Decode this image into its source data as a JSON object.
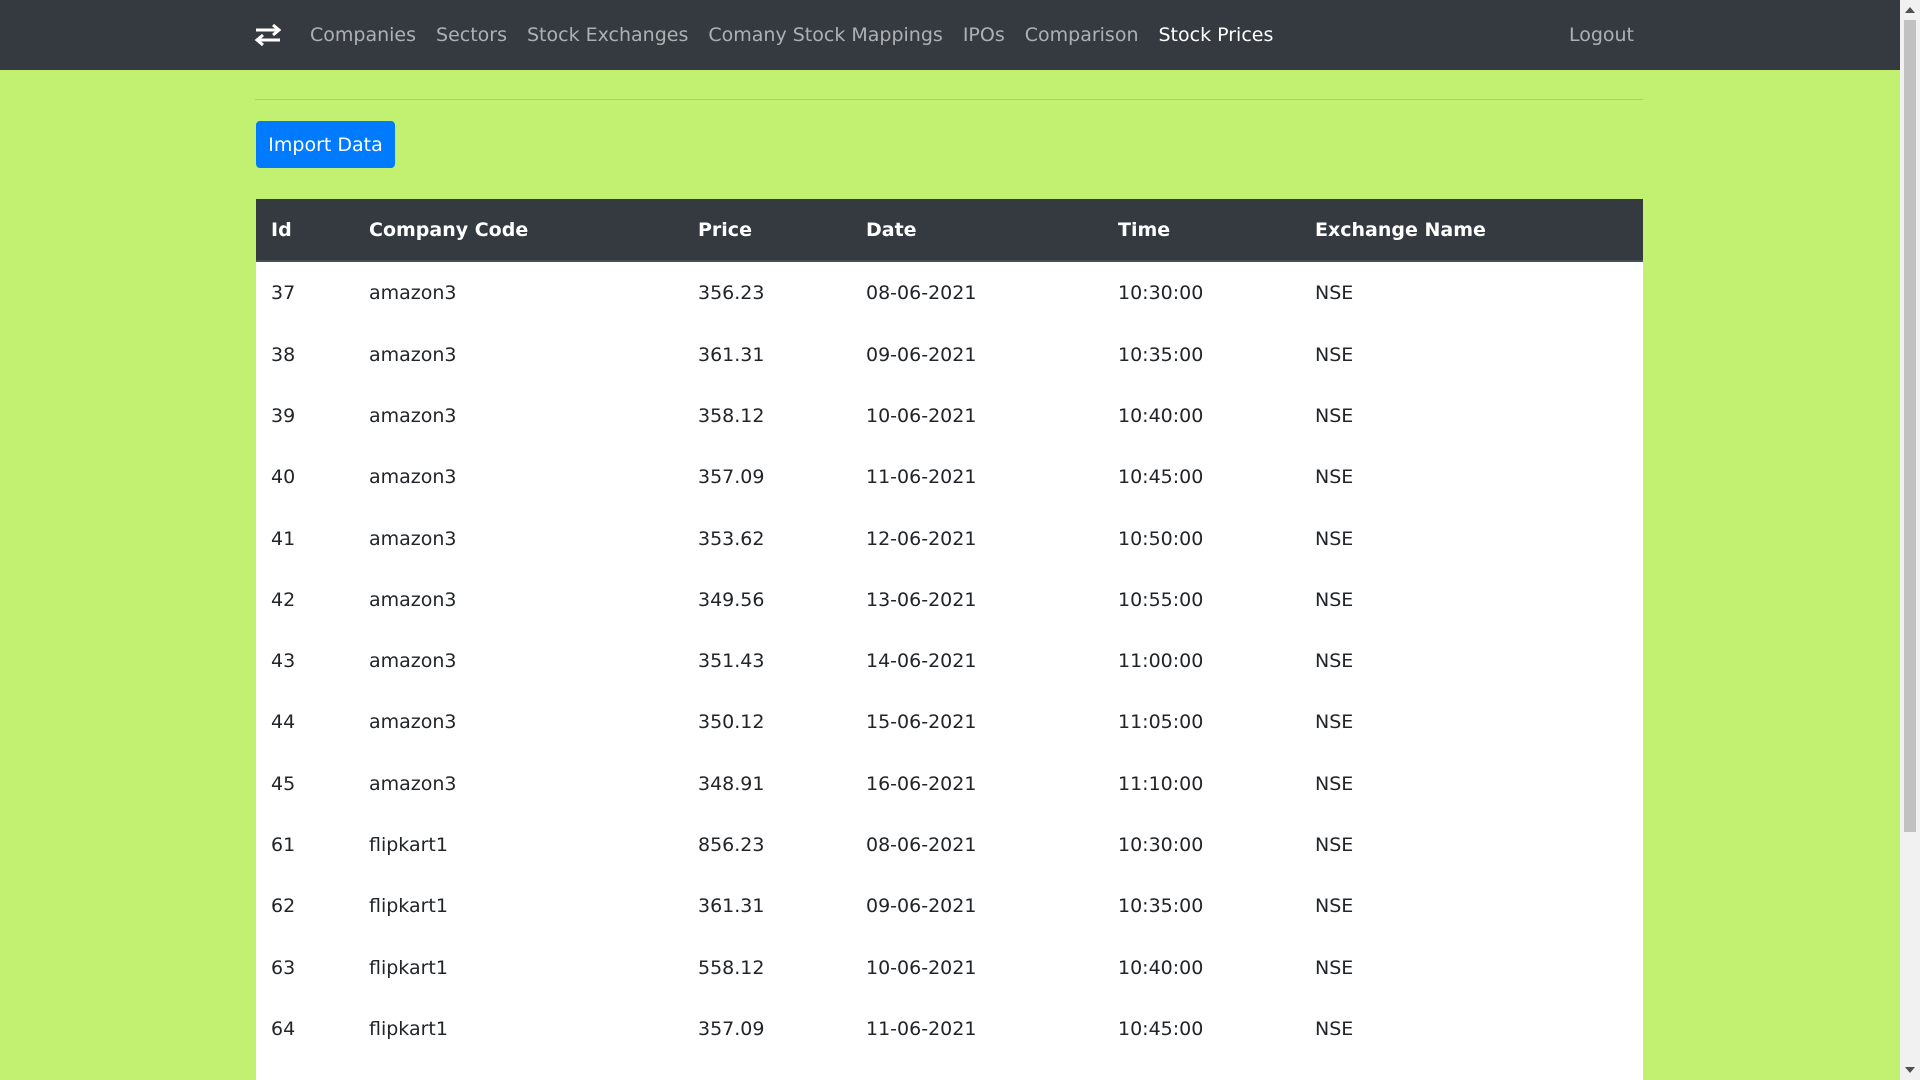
{
  "navbar": {
    "brand_icon": "arrows-exchange-icon",
    "links": [
      {
        "label": "Companies",
        "active": false
      },
      {
        "label": "Sectors",
        "active": false
      },
      {
        "label": "Stock Exchanges",
        "active": false
      },
      {
        "label": "Comany Stock Mappings",
        "active": false
      },
      {
        "label": "IPOs",
        "active": false
      },
      {
        "label": "Comparison",
        "active": false
      },
      {
        "label": "Stock Prices",
        "active": true
      }
    ],
    "logout_label": "Logout"
  },
  "import_button_label": "Import Data",
  "table": {
    "headers": [
      "Id",
      "Company Code",
      "Price",
      "Date",
      "Time",
      "Exchange Name"
    ],
    "rows": [
      [
        "37",
        "amazon3",
        "356.23",
        "08-06-2021",
        "10:30:00",
        "NSE"
      ],
      [
        "38",
        "amazon3",
        "361.31",
        "09-06-2021",
        "10:35:00",
        "NSE"
      ],
      [
        "39",
        "amazon3",
        "358.12",
        "10-06-2021",
        "10:40:00",
        "NSE"
      ],
      [
        "40",
        "amazon3",
        "357.09",
        "11-06-2021",
        "10:45:00",
        "NSE"
      ],
      [
        "41",
        "amazon3",
        "353.62",
        "12-06-2021",
        "10:50:00",
        "NSE"
      ],
      [
        "42",
        "amazon3",
        "349.56",
        "13-06-2021",
        "10:55:00",
        "NSE"
      ],
      [
        "43",
        "amazon3",
        "351.43",
        "14-06-2021",
        "11:00:00",
        "NSE"
      ],
      [
        "44",
        "amazon3",
        "350.12",
        "15-06-2021",
        "11:05:00",
        "NSE"
      ],
      [
        "45",
        "amazon3",
        "348.91",
        "16-06-2021",
        "11:10:00",
        "NSE"
      ],
      [
        "61",
        "flipkart1",
        "856.23",
        "08-06-2021",
        "10:30:00",
        "NSE"
      ],
      [
        "62",
        "flipkart1",
        "361.31",
        "09-06-2021",
        "10:35:00",
        "NSE"
      ],
      [
        "63",
        "flipkart1",
        "558.12",
        "10-06-2021",
        "10:40:00",
        "NSE"
      ],
      [
        "64",
        "flipkart1",
        "357.09",
        "11-06-2021",
        "10:45:00",
        "NSE"
      ]
    ]
  },
  "colors": {
    "page_background": "#c2f071",
    "navbar_background": "#343a40",
    "primary_button": "#007bff",
    "table_header_background": "#343a40"
  }
}
